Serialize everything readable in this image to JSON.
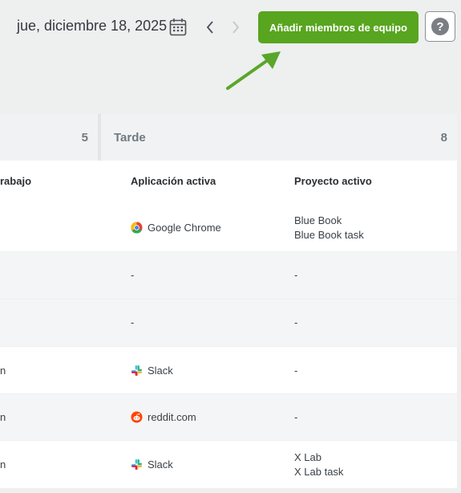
{
  "header": {
    "date": "jue, diciembre 18, 2025",
    "add_button": "Añadir miembros de equipo",
    "help_symbol": "?"
  },
  "summary": [
    {
      "label": "",
      "count": "5"
    },
    {
      "label": "Tarde",
      "count": "8"
    }
  ],
  "columns": {
    "work": "rabajo",
    "app": "Aplicación activa",
    "project": "Proyecto activo"
  },
  "rows": [
    {
      "left": "",
      "app": "Google Chrome",
      "app_icon": "chrome-icon",
      "project": [
        "Blue Book",
        "Blue Book task"
      ]
    },
    {
      "left": "",
      "app": "-",
      "app_icon": "",
      "project": [
        "-"
      ]
    },
    {
      "left": "",
      "app": "-",
      "app_icon": "",
      "project": [
        "-"
      ]
    },
    {
      "left": "n",
      "app": "Slack",
      "app_icon": "slack-icon",
      "project": [
        "-"
      ]
    },
    {
      "left": "n",
      "app": "reddit.com",
      "app_icon": "reddit-icon",
      "project": [
        "-"
      ]
    },
    {
      "left": "n",
      "app": "Slack",
      "app_icon": "slack-icon",
      "project": [
        "X Lab",
        "X Lab task"
      ]
    }
  ],
  "colors": {
    "accent": "#58a520",
    "arrow": "#5aa62a",
    "background": "#eeefef"
  }
}
